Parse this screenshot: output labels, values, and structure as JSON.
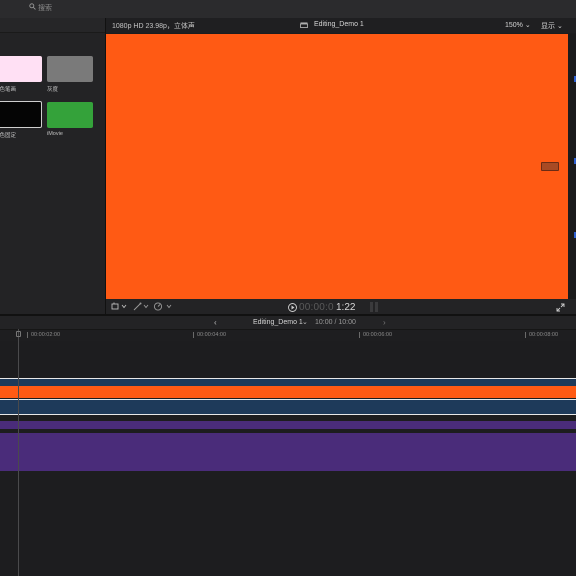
{
  "browser": {
    "search_placeholder": "搜索",
    "thumbnails": [
      {
        "label": "彩色笔画",
        "color": "#ffe0f4"
      },
      {
        "label": "灰度",
        "color": "#7a7a7a"
      },
      {
        "label": "黑色固定",
        "color": "#050505"
      },
      {
        "label": "iMovie",
        "color": "#34a23a"
      }
    ]
  },
  "viewer": {
    "format": "1080p HD 23.98p，立体声",
    "title": "Editing_Demo 1",
    "zoom": "150%",
    "view": "显示",
    "canvas_color": "#ff5a14"
  },
  "transport": {
    "timecode_prefix": "00:00:0",
    "timecode_value": "1:22"
  },
  "timeline": {
    "project_name": "Editing_Demo 1",
    "duration": "10:00 / 10:00",
    "ruler_labels": [
      "00:00:02:00",
      "00:00:04:00",
      "00:00:06:00",
      "00:00:08:00"
    ]
  },
  "colors": {
    "video_clip": "#ff5a14",
    "audio_clip": "#1e3a5a",
    "music_clip": "#4a2c7a",
    "accent": "#2d5fd0"
  }
}
